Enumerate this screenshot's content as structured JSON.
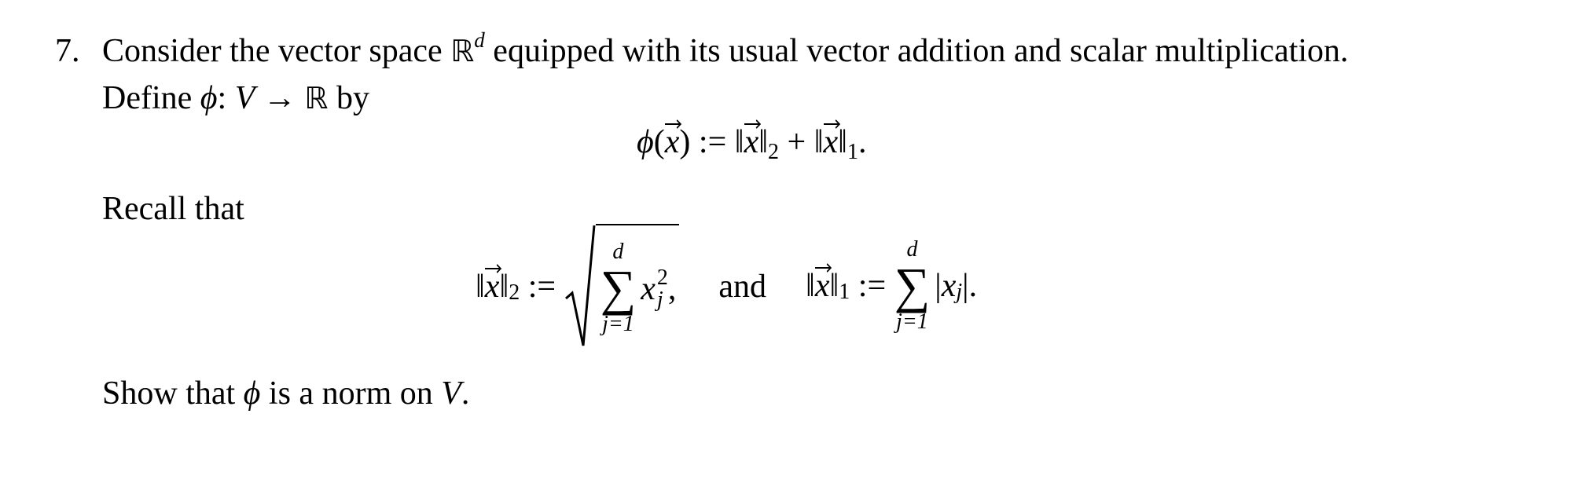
{
  "problem": {
    "number": "7.",
    "line1": {
      "before_space": "Consider the vector space ",
      "space_symbol": "ℝ",
      "space_exponent": "d",
      "after_space": " equipped with its usual vector addition and scalar multiplication."
    },
    "line2": {
      "prefix": "Define ",
      "phi": "ϕ",
      "colon": ":",
      "domain": "V",
      "arrow": "→",
      "codomain": "ℝ",
      "suffix": " by"
    },
    "definition": {
      "lhs_func": "ϕ",
      "open_paren": "(",
      "var": "x",
      "close_paren": ")",
      "assign": " := ",
      "norm_bars": "‖",
      "sub2": "2",
      "plus": " + ",
      "sub1": "1",
      "end": "."
    },
    "recall": "Recall that",
    "norms": {
      "l2": {
        "var": "x",
        "norm_bars": "‖",
        "sub": "2",
        "assign": " := ",
        "sum_upper": "d",
        "sum_symbol": "∑",
        "sum_lower": "j=1",
        "term_var": "x",
        "term_sub": "j",
        "term_sup": "2",
        "trail": ","
      },
      "connector": "and",
      "l1": {
        "var": "x",
        "norm_bars": "‖",
        "sub": "1",
        "assign": " := ",
        "sum_upper": "d",
        "sum_symbol": "∑",
        "sum_lower": "j=1",
        "abs_bar": "|",
        "term_var": "x",
        "term_sub": "j",
        "trail": "."
      }
    },
    "conclusion": {
      "prefix": "Show that ",
      "phi": "ϕ",
      "middle": " is a norm on ",
      "space": "V",
      "end": "."
    }
  }
}
